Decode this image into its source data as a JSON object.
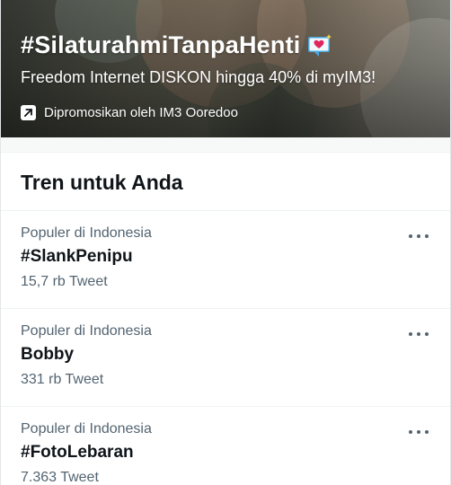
{
  "promo": {
    "hashtag": "#SilaturahmiTanpaHenti",
    "emoji_icon": "love-letter-icon",
    "subtitle": "Freedom Internet DISKON hingga 40% di myIM3!",
    "promoted_icon": "promoted-arrow-icon",
    "promoted_label": "Dipromosikan oleh IM3 Ooredoo"
  },
  "trends": {
    "title": "Tren untuk Anda",
    "more_icon": "more-options-icon",
    "items": [
      {
        "context": "Populer di Indonesia",
        "name": "#SlankPenipu",
        "count": "15,7 rb Tweet"
      },
      {
        "context": "Populer di Indonesia",
        "name": "Bobby",
        "count": "331 rb Tweet"
      },
      {
        "context": "Populer di Indonesia",
        "name": "#FotoLebaran",
        "count": "7.363 Tweet"
      }
    ]
  },
  "colors": {
    "text_primary": "#0f1419",
    "text_secondary": "#536471",
    "divider": "#eff3f4",
    "emoji_bg": "#4aa8e0",
    "emoji_heart": "#e0245e"
  }
}
